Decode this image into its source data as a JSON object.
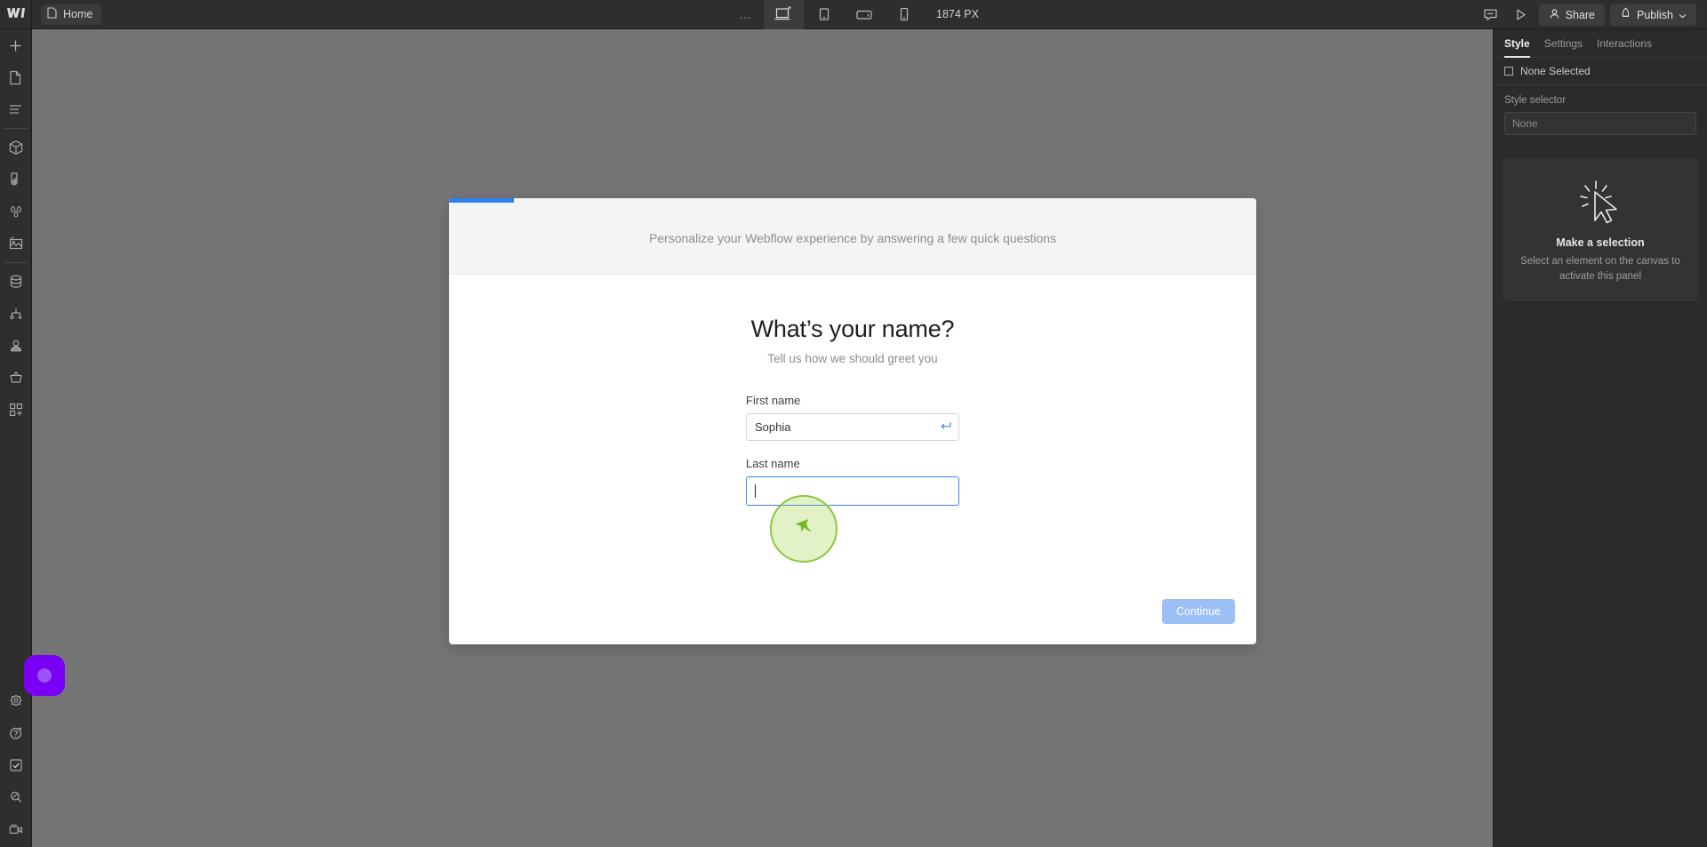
{
  "app": {
    "name": "Webflow Designer",
    "logo_icon": "webflow-logo-icon"
  },
  "topbar": {
    "page_pill": {
      "label": "Home",
      "icon": "page-icon"
    },
    "more_menu": {
      "label": "…",
      "icon": "ellipsis-icon"
    },
    "breakpoints": [
      {
        "name": "desktop",
        "icon": "desktop-icon",
        "active": true,
        "badge": "*"
      },
      {
        "name": "tablet",
        "icon": "tablet-icon",
        "active": false
      },
      {
        "name": "mobile-landscape",
        "icon": "mobile-landscape-icon",
        "active": false
      },
      {
        "name": "mobile-portrait",
        "icon": "mobile-portrait-icon",
        "active": false
      }
    ],
    "viewport_size": "1874 PX",
    "comment_icon": "comment-icon",
    "preview_icon": "preview-play-icon",
    "share": {
      "label": "Share",
      "icon": "person-icon"
    },
    "publish": {
      "label": "Publish",
      "icon": "rocket-icon",
      "chevron": "chevron-down-icon"
    }
  },
  "left_rail": {
    "top_items": [
      {
        "name": "add-elements",
        "icon": "plus-icon"
      },
      {
        "name": "pages",
        "icon": "page-icon"
      },
      {
        "name": "navigator",
        "icon": "navigator-icon"
      }
    ],
    "mid_items": [
      {
        "name": "components",
        "icon": "cube-icon"
      },
      {
        "name": "style-manager",
        "icon": "paint-swatch-icon"
      },
      {
        "name": "variables",
        "icon": "droplets-icon"
      },
      {
        "name": "assets",
        "icon": "image-icon"
      }
    ],
    "data_items": [
      {
        "name": "cms",
        "icon": "database-icon"
      },
      {
        "name": "logic",
        "icon": "logic-flow-icon"
      },
      {
        "name": "users",
        "icon": "user-icon"
      },
      {
        "name": "ecommerce",
        "icon": "basket-icon"
      },
      {
        "name": "apps",
        "icon": "apps-grid-icon"
      }
    ],
    "bottom_items": [
      {
        "name": "settings",
        "icon": "gear-icon"
      },
      {
        "name": "help",
        "icon": "help-sparkle-icon"
      },
      {
        "name": "audit",
        "icon": "checkbox-icon"
      },
      {
        "name": "search",
        "icon": "search-slash-icon"
      },
      {
        "name": "video-tutorials",
        "icon": "video-camera-icon"
      }
    ],
    "fab": {
      "name": "assistant-fab",
      "icon": "purple-circle-icon",
      "color": "#7a00f5"
    }
  },
  "right_panel": {
    "tabs": [
      {
        "label": "Style",
        "active": true
      },
      {
        "label": "Settings",
        "active": false
      },
      {
        "label": "Interactions",
        "active": false
      }
    ],
    "selection_status": {
      "label": "None Selected",
      "icon": "square-icon"
    },
    "style_selector": {
      "label": "Style selector",
      "placeholder": "None",
      "value": ""
    },
    "empty_state": {
      "icon": "click-cursor-icon",
      "title": "Make a selection",
      "description": "Select an element on the canvas to activate this panel"
    }
  },
  "modal": {
    "progress": {
      "percent": 8,
      "color": "#2b7fee"
    },
    "header_text": "Personalize your Webflow experience by answering a few quick questions",
    "title": "What’s your name?",
    "subtitle": "Tell us how we should greet you",
    "fields": [
      {
        "label": "First name",
        "value": "Sophia",
        "placeholder": "",
        "focused": false,
        "icon": "enter-return-icon"
      },
      {
        "label": "Last name",
        "value": "",
        "placeholder": "",
        "focused": true,
        "icon": ""
      }
    ],
    "continue_button": {
      "label": "Continue",
      "disabled": true,
      "color": "#9cc0f5"
    }
  },
  "annotation": {
    "click_indicator": {
      "icon": "green-cursor-icon",
      "color": "#8dc63f"
    }
  }
}
